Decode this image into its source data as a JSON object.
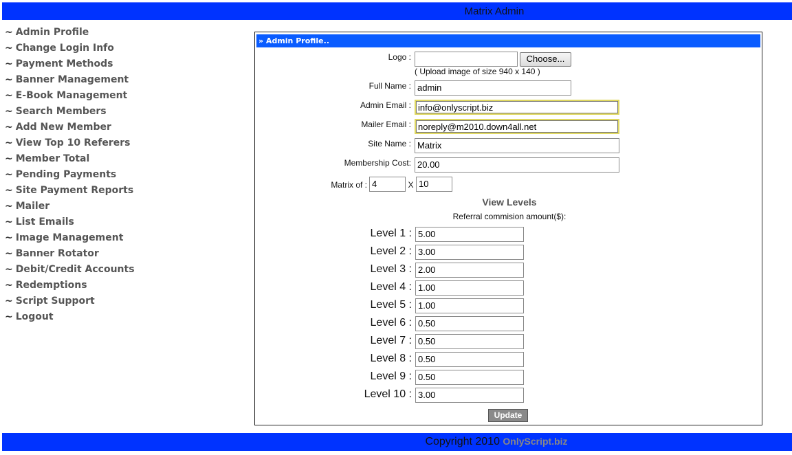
{
  "header": {
    "title": "Matrix Admin"
  },
  "sidebar": {
    "items": [
      {
        "label": "Admin Profile"
      },
      {
        "label": "Change Login Info"
      },
      {
        "label": "Payment Methods"
      },
      {
        "label": "Banner Management"
      },
      {
        "label": "E-Book Management"
      },
      {
        "label": "Search Members"
      },
      {
        "label": "Add New Member"
      },
      {
        "label": "View Top 10 Referers"
      },
      {
        "label": "Member Total"
      },
      {
        "label": "Pending Payments"
      },
      {
        "label": "Site Payment Reports"
      },
      {
        "label": "Mailer"
      },
      {
        "label": "List Emails"
      },
      {
        "label": "Image Management"
      },
      {
        "label": "Banner Rotator"
      },
      {
        "label": "Debit/Credit Accounts"
      },
      {
        "label": "Redemptions"
      },
      {
        "label": "Script Support"
      },
      {
        "label": "Logout"
      }
    ]
  },
  "panel": {
    "header": "» Admin Profile..",
    "logo_label": "Logo :",
    "choose_label": "Choose...",
    "logo_hint": "( Upload image of size 940 x 140 )",
    "full_name_label": "Full Name :",
    "full_name": "admin",
    "admin_email_label": "Admin Email :",
    "admin_email": "info@onlyscript.biz",
    "mailer_email_label": "Mailer Email :",
    "mailer_email": "noreply@m2010.down4all.net",
    "site_name_label": "Site Name :",
    "site_name": "Matrix",
    "membership_cost_label": "Membership Cost:",
    "membership_cost": "20.00",
    "matrix_label": "Matrix of :",
    "matrix_width": "4",
    "matrix_x": "X",
    "matrix_depth": "10",
    "levels_title": "View Levels",
    "levels_subtitle": "Referral commision amount($):",
    "levels": [
      {
        "label": "Level 1 :",
        "value": "5.00"
      },
      {
        "label": "Level 2 :",
        "value": "3.00"
      },
      {
        "label": "Level 3 :",
        "value": "2.00"
      },
      {
        "label": "Level 4 :",
        "value": "1.00"
      },
      {
        "label": "Level 5 :",
        "value": "1.00"
      },
      {
        "label": "Level 6 :",
        "value": "0.50"
      },
      {
        "label": "Level 7 :",
        "value": "0.50"
      },
      {
        "label": "Level 8 :",
        "value": "0.50"
      },
      {
        "label": "Level 9 :",
        "value": "0.50"
      },
      {
        "label": "Level 10 :",
        "value": "3.00"
      }
    ],
    "update_label": "Update"
  },
  "footer": {
    "copyright": "Copyright 2010",
    "brand": "OnlyScript.biz"
  },
  "colors": {
    "bar_blue": "#0033ff",
    "panel_header_blue": "#0a5cff",
    "nav_text": "#555555"
  }
}
